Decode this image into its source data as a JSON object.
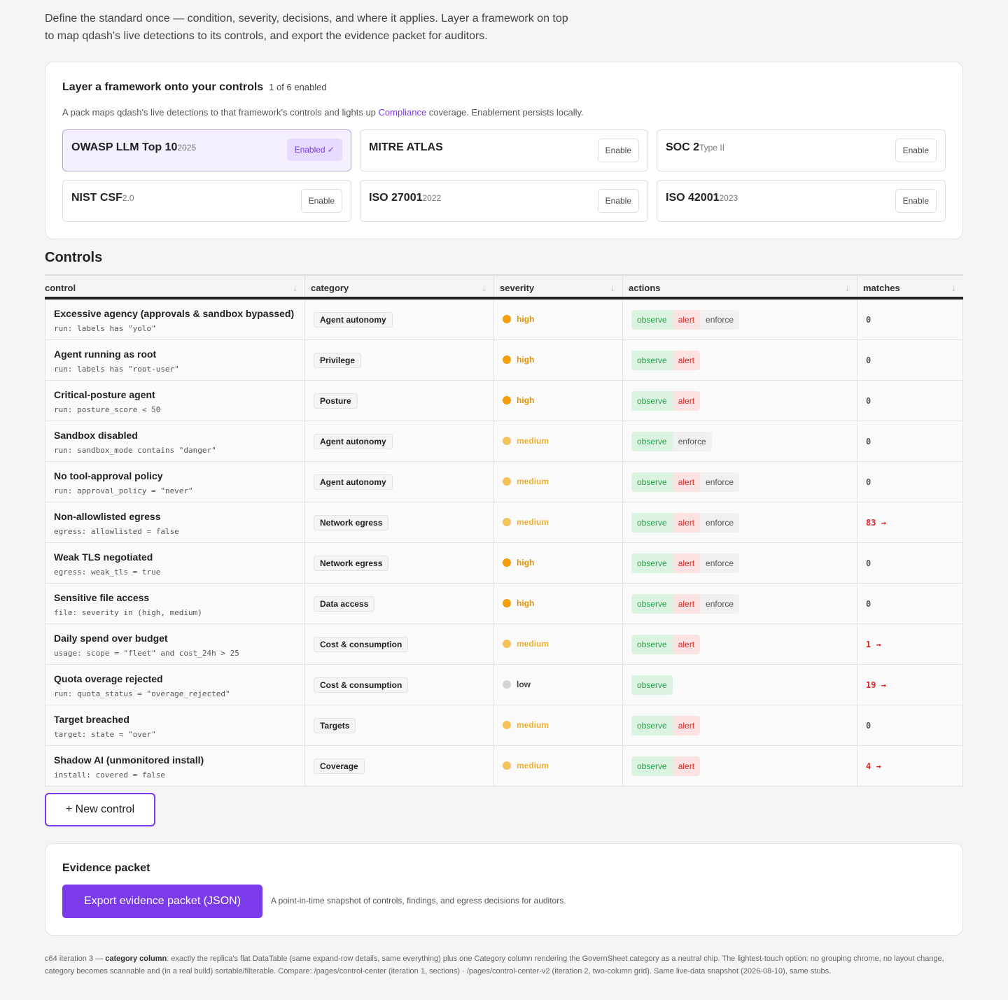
{
  "intro": {
    "line1": "Define the standard once — condition, severity, decisions, and where it applies. Layer a framework on top",
    "line2": "to map qdash's live detections to its controls, and export the evidence packet for auditors."
  },
  "frameworks": {
    "title": "Layer a framework onto your controls",
    "count": "1 of 6 enabled",
    "desc_before": "A pack maps qdash's live detections to that framework's controls and lights up ",
    "desc_link": "Compliance",
    "desc_after": " coverage. Enablement persists locally.",
    "items": [
      {
        "name": "OWASP LLM Top 10",
        "version": "2025",
        "button": "Enabled ✓",
        "enabled": true
      },
      {
        "name": "MITRE ATLAS",
        "version": "",
        "button": "Enable",
        "enabled": false
      },
      {
        "name": "SOC 2",
        "version": "Type II",
        "button": "Enable",
        "enabled": false
      },
      {
        "name": "NIST CSF",
        "version": "2.0",
        "button": "Enable",
        "enabled": false
      },
      {
        "name": "ISO 27001",
        "version": "2022",
        "button": "Enable",
        "enabled": false
      },
      {
        "name": "ISO 42001",
        "version": "2023",
        "button": "Enable",
        "enabled": false
      }
    ]
  },
  "controls": {
    "title": "Controls",
    "columns": [
      "control",
      "category",
      "severity",
      "actions",
      "matches"
    ],
    "sort_icon": "arrow-down-icon",
    "severity_colors": {
      "high": "#f59e0b",
      "medium": "#f5c35b",
      "low": "#d4d4d4"
    },
    "severity_text_colors": {
      "high": "#e59400",
      "medium": "#f0b030",
      "low": "#444444"
    },
    "rows": [
      {
        "name": "Excessive agency (approvals & sandbox bypassed)",
        "rule": "run: labels has \"yolo\"",
        "category": "Agent autonomy",
        "severity": "high",
        "actions": [
          "observe",
          "alert",
          "enforce"
        ],
        "matches": "0",
        "hot": false
      },
      {
        "name": "Agent running as root",
        "rule": "run: labels has \"root-user\"",
        "category": "Privilege",
        "severity": "high",
        "actions": [
          "observe",
          "alert"
        ],
        "matches": "0",
        "hot": false
      },
      {
        "name": "Critical-posture agent",
        "rule": "run: posture_score < 50",
        "category": "Posture",
        "severity": "high",
        "actions": [
          "observe",
          "alert"
        ],
        "matches": "0",
        "hot": false
      },
      {
        "name": "Sandbox disabled",
        "rule": "run: sandbox_mode contains \"danger\"",
        "category": "Agent autonomy",
        "severity": "medium",
        "actions": [
          "observe",
          "enforce"
        ],
        "matches": "0",
        "hot": false
      },
      {
        "name": "No tool-approval policy",
        "rule": "run: approval_policy = \"never\"",
        "category": "Agent autonomy",
        "severity": "medium",
        "actions": [
          "observe",
          "alert",
          "enforce"
        ],
        "matches": "0",
        "hot": false
      },
      {
        "name": "Non-allowlisted egress",
        "rule": "egress: allowlisted = false",
        "category": "Network egress",
        "severity": "medium",
        "actions": [
          "observe",
          "alert",
          "enforce"
        ],
        "matches": "83 →",
        "hot": true
      },
      {
        "name": "Weak TLS negotiated",
        "rule": "egress: weak_tls = true",
        "category": "Network egress",
        "severity": "high",
        "actions": [
          "observe",
          "alert",
          "enforce"
        ],
        "matches": "0",
        "hot": false
      },
      {
        "name": "Sensitive file access",
        "rule": "file: severity in (high, medium)",
        "category": "Data access",
        "severity": "high",
        "actions": [
          "observe",
          "alert",
          "enforce"
        ],
        "matches": "0",
        "hot": false
      },
      {
        "name": "Daily spend over budget",
        "rule": "usage: scope = \"fleet\" and cost_24h > 25",
        "category": "Cost & consumption",
        "severity": "medium",
        "actions": [
          "observe",
          "alert"
        ],
        "matches": "1 →",
        "hot": true
      },
      {
        "name": "Quota overage rejected",
        "rule": "run: quota_status = \"overage_rejected\"",
        "category": "Cost & consumption",
        "severity": "low",
        "actions": [
          "observe"
        ],
        "matches": "19 →",
        "hot": true
      },
      {
        "name": "Target breached",
        "rule": "target: state = \"over\"",
        "category": "Targets",
        "severity": "medium",
        "actions": [
          "observe",
          "alert"
        ],
        "matches": "0",
        "hot": false
      },
      {
        "name": "Shadow AI (unmonitored install)",
        "rule": "install: covered = false",
        "category": "Coverage",
        "severity": "medium",
        "actions": [
          "observe",
          "alert"
        ],
        "matches": "4 →",
        "hot": true
      }
    ],
    "new_button": "+ New control"
  },
  "evidence": {
    "title": "Evidence packet",
    "button": "Export evidence packet (JSON)",
    "desc": "A point-in-time snapshot of controls, findings, and egress decisions for auditors."
  },
  "footnote": {
    "prefix": "c64 iteration 3 — ",
    "bold": "category column",
    "text": ": exactly the replica's flat DataTable (same expand-row details, same everything) plus one Category column rendering the GovernSheet category as a neutral chip. The lightest-touch option: no grouping chrome, no layout change, category becomes scannable and (in a real build) sortable/filterable. Compare: /pages/control-center (iteration 1, sections) · /pages/control-center-v2 (iteration 2, two-column grid). Same live-data snapshot (2026-08-10), same stubs."
  }
}
